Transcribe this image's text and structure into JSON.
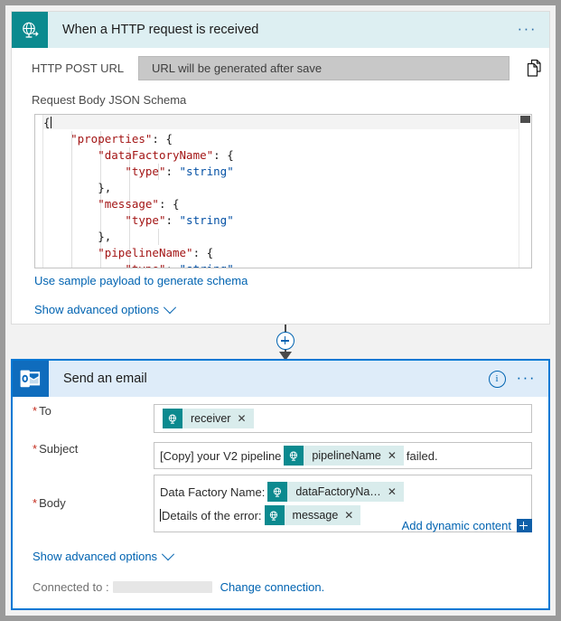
{
  "trigger_card": {
    "icon": "http-request-icon",
    "title": "When a HTTP request is received",
    "overflow": "···",
    "post_url_label": "HTTP POST URL",
    "post_url_value": "URL will be generated after save",
    "copy_icon": "copy-icon",
    "schema_label": "Request Body JSON Schema",
    "schema_lines": [
      {
        "indent": 0,
        "parts": [
          {
            "t": "{",
            "c": "pun"
          }
        ]
      },
      {
        "indent": 1,
        "parts": [
          {
            "t": "\"properties\"",
            "c": "key"
          },
          {
            "t": ": {",
            "c": "pun"
          }
        ]
      },
      {
        "indent": 2,
        "parts": [
          {
            "t": "\"dataFactoryName\"",
            "c": "key"
          },
          {
            "t": ": {",
            "c": "pun"
          }
        ]
      },
      {
        "indent": 3,
        "parts": [
          {
            "t": "\"type\"",
            "c": "key"
          },
          {
            "t": ": ",
            "c": "pun"
          },
          {
            "t": "\"string\"",
            "c": "str"
          }
        ]
      },
      {
        "indent": 2,
        "parts": [
          {
            "t": "},",
            "c": "pun"
          }
        ]
      },
      {
        "indent": 2,
        "parts": [
          {
            "t": "\"message\"",
            "c": "key"
          },
          {
            "t": ": {",
            "c": "pun"
          }
        ]
      },
      {
        "indent": 3,
        "parts": [
          {
            "t": "\"type\"",
            "c": "key"
          },
          {
            "t": ": ",
            "c": "pun"
          },
          {
            "t": "\"string\"",
            "c": "str"
          }
        ]
      },
      {
        "indent": 2,
        "parts": [
          {
            "t": "},",
            "c": "pun"
          }
        ]
      },
      {
        "indent": 2,
        "parts": [
          {
            "t": "\"pipelineName\"",
            "c": "key"
          },
          {
            "t": ": {",
            "c": "pun"
          }
        ]
      },
      {
        "indent": 3,
        "parts": [
          {
            "t": "\"type\"",
            "c": "key"
          },
          {
            "t": ": ",
            "c": "pun"
          },
          {
            "t": "\"string\"",
            "c": "str"
          }
        ]
      }
    ],
    "sample_payload_link": "Use sample payload to generate schema",
    "advanced_options_link": "Show advanced options"
  },
  "connector": {
    "add_step_icon": "plus-circle-icon"
  },
  "action_card": {
    "icon": "outlook-icon",
    "title": "Send an email",
    "info_icon": "info-icon",
    "overflow": "···",
    "fields": {
      "to": {
        "label": "To",
        "required": "*",
        "tokens": [
          {
            "label": "receiver",
            "remove": "✕"
          }
        ]
      },
      "subject": {
        "label": "Subject",
        "required": "*",
        "text_before": "[Copy] your V2 pipeline",
        "token": {
          "label": "pipelineName",
          "remove": "✕"
        },
        "text_after": "failed."
      },
      "body": {
        "label": "Body",
        "required": "*",
        "line1_text": "Data Factory Name:",
        "line1_token": {
          "label": "dataFactoryNa…",
          "remove": "✕"
        },
        "line2_text": "Details of the error:",
        "line2_token": {
          "label": "message",
          "remove": "✕"
        }
      }
    },
    "add_dynamic_content": "Add dynamic content",
    "advanced_options_link": "Show advanced options",
    "connected_to_label": "Connected to :",
    "connected_to_value": "",
    "change_connection_link": "Change connection."
  },
  "colors": {
    "teal": "#0b8a8f",
    "outlook_blue": "#0f6cbd",
    "accent_blue": "#0063b1",
    "selected_border": "#0078d4",
    "required_red": "#c42b1c"
  }
}
